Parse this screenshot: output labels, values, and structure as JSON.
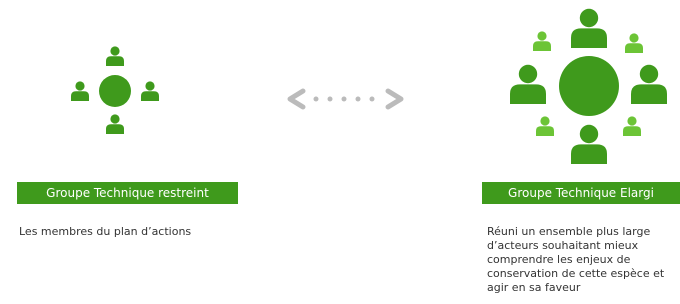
{
  "colors": {
    "dark_green": "#3f9a1c",
    "light_green": "#6cc436",
    "label_bg": "#3f9a1c",
    "arrow_gray": "#bbbbbb"
  },
  "left_group": {
    "label": "Groupe Technique restreint",
    "description": "Les membres du plan d’actions",
    "icons": [
      "table-icon",
      "person-icon"
    ]
  },
  "connector": {
    "icon": "double-arrow-icon"
  },
  "right_group": {
    "label": "Groupe Technique Elargi",
    "description": "Réuni un ensemble plus large\nd’acteurs souhaitant mieux\ncomprendre les enjeux de\nconservation de cette espèce et\nagir en sa faveur",
    "icons": [
      "table-icon",
      "person-icon"
    ]
  }
}
